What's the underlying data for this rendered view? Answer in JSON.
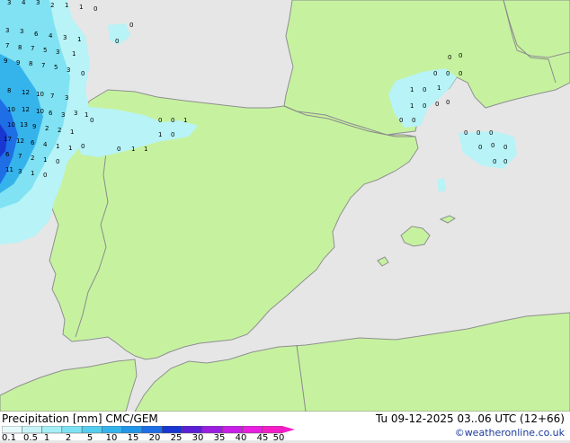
{
  "map": {
    "colors": {
      "sea": "#e6e6e6",
      "land": "#c6f2a0",
      "border": "#8a8a8a",
      "coast": "#8f8f8f",
      "precip_light": "#b7f3f7",
      "precip_mid": "#80e2f2",
      "precip_high": "#35b4ec",
      "precip_heavy": "#1e6ee6",
      "precip_max": "#1836d2"
    },
    "cell_values_top_left": [
      "3",
      "4",
      "3",
      "2",
      "1",
      "1",
      "0",
      "3",
      "3",
      "6",
      "4",
      "3",
      "1",
      "7",
      "8",
      "7",
      "5",
      "3",
      "1",
      "9",
      "9",
      "8",
      "7",
      "5",
      "3",
      "0",
      "8",
      "12",
      "10",
      "7",
      "3",
      "10",
      "12",
      "10",
      "6",
      "3",
      "3",
      "1",
      "0",
      "10",
      "13",
      "9",
      "2",
      "2",
      "1",
      "17",
      "12",
      "6",
      "4",
      "1",
      "1",
      "0",
      "6",
      "7",
      "2",
      "1",
      "0",
      "11",
      "3",
      "1",
      "0"
    ],
    "cell_values_other": [
      "0",
      "0",
      "0",
      "0",
      "1",
      "1",
      "0",
      "0",
      "1",
      "1",
      "1",
      "0",
      "1",
      "1",
      "0",
      "0",
      "0",
      "0",
      "0",
      "0",
      "0",
      "0",
      "0",
      "0",
      "0",
      "0",
      "0",
      "0",
      "0",
      "0",
      "0",
      "0"
    ]
  },
  "footer": {
    "title": "Precipitation [mm]  CMC/GEM",
    "datetime": "Tu 09-12-2025 03..06 UTC (12+66)",
    "credit": "©weatheronline.co.uk",
    "legend_ticks": [
      "0.1",
      "0.5",
      "1",
      "2",
      "5",
      "10",
      "15",
      "20",
      "25",
      "30",
      "35",
      "40",
      "45",
      "50"
    ],
    "legend_colors": [
      "#e6f9fb",
      "#c8f4f8",
      "#a6eef6",
      "#7fe2f3",
      "#55cdef",
      "#35b4ec",
      "#2196e8",
      "#1e6ee6",
      "#1836d2",
      "#5a1fd6",
      "#9a1ee0",
      "#c81ee6",
      "#e81ee0",
      "#f41ec8"
    ]
  }
}
